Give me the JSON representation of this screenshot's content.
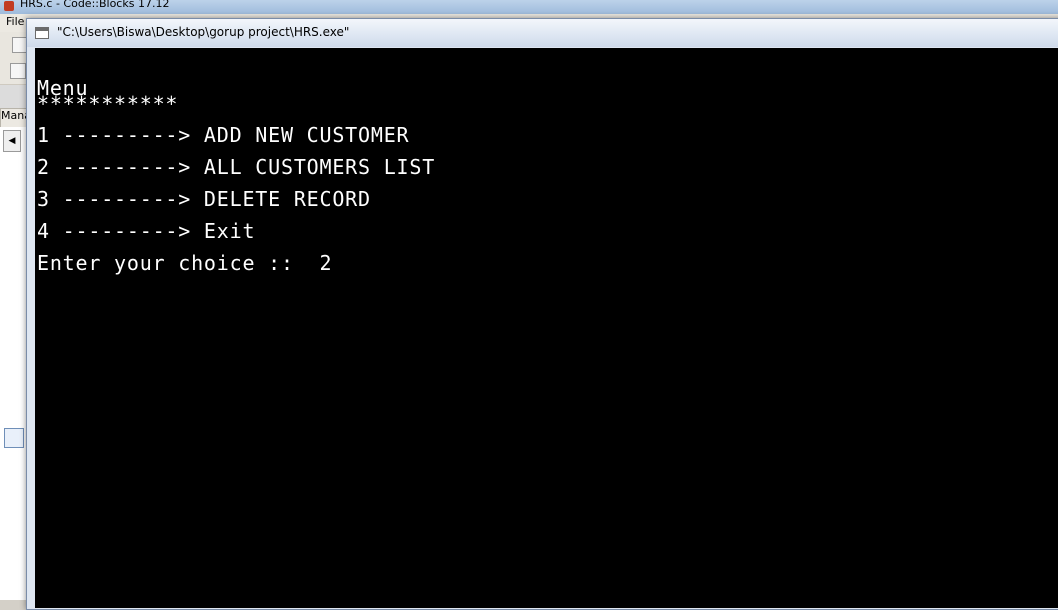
{
  "ide": {
    "title": "HRS.c - Code::Blocks 17.12",
    "menu_file": "File",
    "management_tab": "Mana",
    "scroll_left_icon": "chevron-left-icon",
    "list_icon": "list-icon"
  },
  "console": {
    "title": "\"C:\\Users\\Biswa\\Desktop\\gorup project\\HRS.exe\"",
    "icon": "console-window-icon",
    "background": "#000000",
    "foreground": "#ffffff",
    "lines": {
      "menu_heading": "Menu",
      "separator": "***********",
      "option_1": "1 ---------> ADD NEW CUSTOMER",
      "option_2": "2 ---------> ALL CUSTOMERS LIST",
      "option_3": "3 ---------> DELETE RECORD",
      "option_4": "4 ---------> Exit",
      "prompt": "Enter your choice ::  2"
    }
  }
}
